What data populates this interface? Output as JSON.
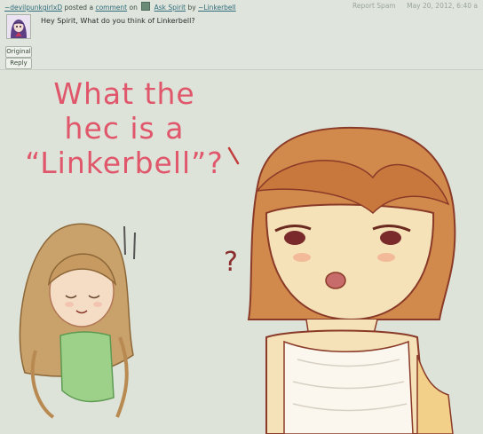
{
  "comment": {
    "author": "~devilpunkgirlxD",
    "posted": "posted a",
    "comment_link": "comment",
    "on": "on",
    "deviation": "Ask Spirit",
    "by": "by",
    "artist": "~Linkerbell",
    "report": "Report Spam",
    "date": "May 20, 2012, 6:40 a",
    "body": "Hey Spirit, What do you think of Linkerbell?",
    "original_label": "Original",
    "reply_label": "Reply"
  },
  "artwork": {
    "caption_lines": [
      "What  the",
      "hec is a",
      "“Linkerbell”?"
    ],
    "question_mark": "?"
  },
  "colors": {
    "caption": "#e0566a",
    "background": "#dde3d9",
    "link": "#2f6b7b"
  }
}
